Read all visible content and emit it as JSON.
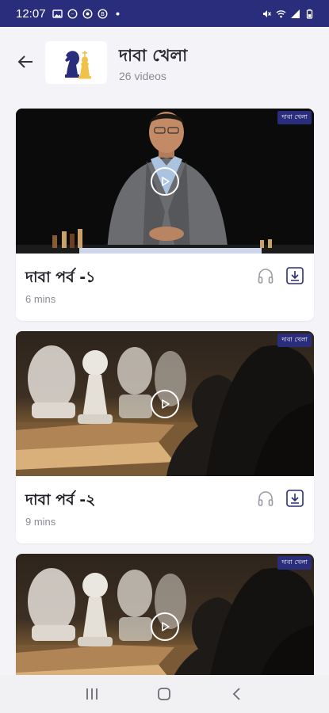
{
  "status_bar": {
    "time": "12:07",
    "icons_left": [
      "image-icon",
      "messenger-icon",
      "whatsapp-icon",
      "badge-icon",
      "dot-icon"
    ],
    "icons_right": [
      "mute-icon",
      "wifi-icon",
      "signal-icon",
      "battery-icon"
    ]
  },
  "header": {
    "title": "দাবা খেলা",
    "subtitle": "26 videos",
    "back_icon": "arrow-left-icon",
    "thumbnail_icon": "chess-pieces-icon"
  },
  "channel_badge": "দাবা খেলা",
  "videos": [
    {
      "title": "দাবা পর্ব -১",
      "duration": "6 mins",
      "thumbnail": "presenter"
    },
    {
      "title": "দাবা পর্ব -২",
      "duration": "9 mins",
      "thumbnail": "chess"
    },
    {
      "title": "",
      "duration": "",
      "thumbnail": "chess"
    }
  ],
  "nav": {
    "recents_icon": "recents-icon",
    "home_icon": "home-icon",
    "back_icon": "chevron-left-icon"
  },
  "colors": {
    "accent": "#2a2c7c",
    "background": "#f4f4f8",
    "card": "#ffffff"
  }
}
